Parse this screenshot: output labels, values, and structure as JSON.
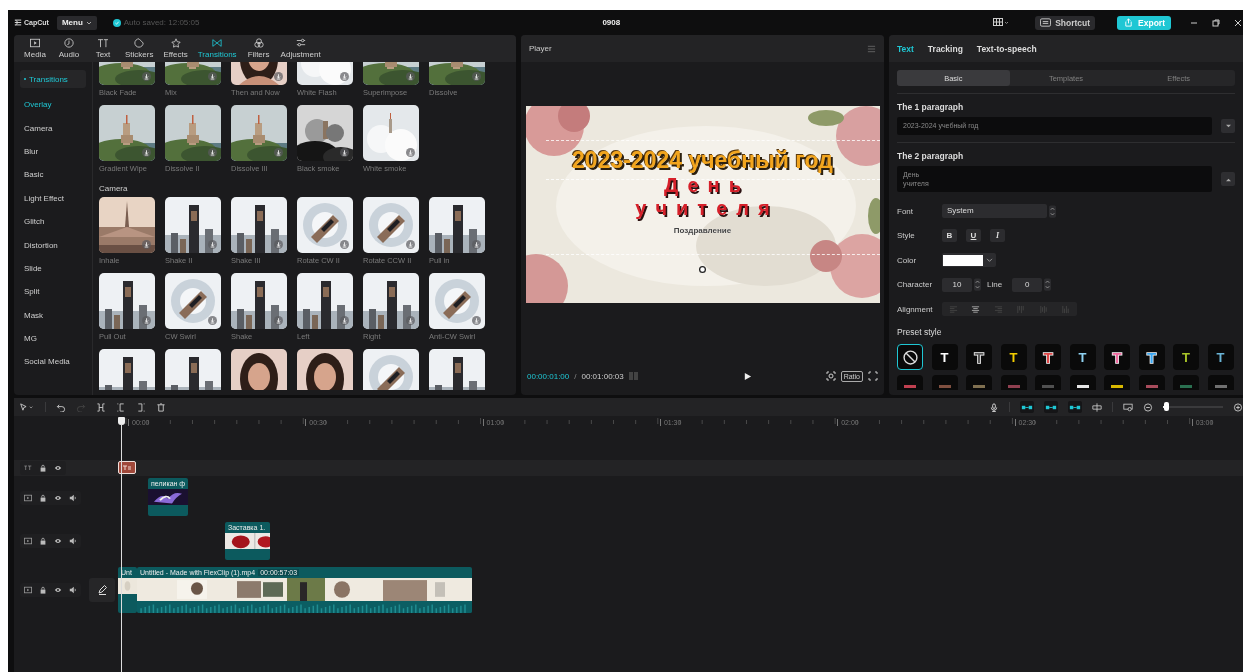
{
  "topbar": {
    "app_name": "CapCut",
    "menu": "Menu",
    "autosave": "Auto saved: 12:05:05",
    "project": "0908",
    "shortcut": "Shortcut",
    "export": "Export"
  },
  "media_tabs": [
    {
      "label": "Media",
      "selected": false
    },
    {
      "label": "Audio",
      "selected": false
    },
    {
      "label": "Text",
      "selected": false
    },
    {
      "label": "Stickers",
      "selected": false
    },
    {
      "label": "Effects",
      "selected": false
    },
    {
      "label": "Transitions",
      "selected": true
    },
    {
      "label": "Filters",
      "selected": false
    },
    {
      "label": "Adjustment",
      "selected": false
    }
  ],
  "sidebar": {
    "items": [
      {
        "label": "Transitions",
        "selected": true,
        "current": false
      },
      {
        "label": "Overlay",
        "selected": false,
        "current": true
      },
      {
        "label": "Camera",
        "selected": false,
        "current": false
      },
      {
        "label": "Blur",
        "selected": false,
        "current": false
      },
      {
        "label": "Basic",
        "selected": false,
        "current": false
      },
      {
        "label": "Light Effect",
        "selected": false,
        "current": false
      },
      {
        "label": "Glitch",
        "selected": false,
        "current": false
      },
      {
        "label": "Distortion",
        "selected": false,
        "current": false
      },
      {
        "label": "Slide",
        "selected": false,
        "current": false
      },
      {
        "label": "Split",
        "selected": false,
        "current": false
      },
      {
        "label": "Mask",
        "selected": false,
        "current": false
      },
      {
        "label": "MG",
        "selected": false,
        "current": false
      },
      {
        "label": "Social Media",
        "selected": false,
        "current": false
      }
    ]
  },
  "library": {
    "sections": [
      {
        "items": [
          {
            "label": "Black Fade"
          },
          {
            "label": "Mix"
          },
          {
            "label": "Then and Now"
          },
          {
            "label": "White Flash"
          },
          {
            "label": "Superimpose"
          },
          {
            "label": "Dissolve"
          },
          {
            "label": "Gradient Wipe"
          },
          {
            "label": "Dissolve II"
          },
          {
            "label": "Dissolve III"
          },
          {
            "label": "Black smoke"
          },
          {
            "label": "White smoke"
          }
        ]
      },
      {
        "heading": "Camera",
        "items": [
          {
            "label": "Inhale"
          },
          {
            "label": "Shake II"
          },
          {
            "label": "Shake III"
          },
          {
            "label": "Rotate CW II"
          },
          {
            "label": "Rotate CCW II"
          },
          {
            "label": "Pull in"
          },
          {
            "label": "Pull Out"
          },
          {
            "label": "CW Swirl"
          },
          {
            "label": "Shake"
          },
          {
            "label": "Left"
          },
          {
            "label": "Right"
          },
          {
            "label": "Anti-CW Swirl"
          },
          {
            "kind": "picture"
          },
          {
            "kind": "picture"
          },
          {
            "kind": "picture"
          },
          {
            "kind": "picture"
          },
          {
            "kind": "picture"
          },
          {
            "kind": "picture"
          }
        ]
      }
    ]
  },
  "player": {
    "title": "Player",
    "overlay_texts": [
      {
        "kind": "title",
        "text": "2023-2024 учебный год"
      },
      {
        "kind": "heading",
        "text": "День"
      },
      {
        "kind": "heading",
        "text": "учителя"
      },
      {
        "kind": "caption",
        "text": "Поздравление"
      }
    ],
    "current_time": "00:00:01:00",
    "separator": "/",
    "duration": "00:01:00:03",
    "ratio": "Ratio"
  },
  "inspector": {
    "tabs": [
      {
        "label": "Text",
        "selected": true
      },
      {
        "label": "Tracking",
        "selected": false
      },
      {
        "label": "Text-to-speech",
        "selected": false
      }
    ],
    "subtabs": [
      {
        "label": "Basic",
        "selected": true
      },
      {
        "label": "Templates",
        "selected": false
      },
      {
        "label": "Effects",
        "selected": false
      }
    ],
    "paragraphs": [
      {
        "label": "The 1 paragraph",
        "value": "2023-2024 учебный год",
        "expanded": false
      },
      {
        "label": "The 2 paragraph",
        "value": "День\nучителя",
        "expanded": true
      }
    ],
    "font": {
      "label": "Font",
      "value": "System"
    },
    "style": {
      "label": "Style",
      "buttons": [
        "B",
        "U",
        "I"
      ]
    },
    "color": {
      "label": "Color",
      "color": "#ffffff"
    },
    "spacing": {
      "character_label": "Character",
      "character": "10",
      "line_label": "Line",
      "line": "0"
    },
    "alignment": {
      "label": "Alignment",
      "options": [
        {
          "selected": false
        },
        {
          "selected": true
        },
        {
          "selected": false
        },
        {
          "selected": false
        },
        {
          "selected": false
        },
        {
          "selected": false
        }
      ]
    },
    "presets": {
      "label": "Preset style",
      "items": [
        {
          "kind": "none",
          "selected": true
        },
        {
          "kind": "text",
          "glyph": "T",
          "color": "#ffffff",
          "selected": false
        },
        {
          "kind": "outline",
          "glyph": "T",
          "color": "#5a5a5a",
          "selected": false
        },
        {
          "kind": "text",
          "glyph": "T",
          "color": "#f2cc00",
          "selected": false
        },
        {
          "kind": "outline",
          "glyph": "T",
          "color": "#e04848",
          "selected": false
        },
        {
          "kind": "text",
          "glyph": "T",
          "color": "#8fd2f2",
          "selected": false
        },
        {
          "kind": "outline",
          "glyph": "T",
          "color": "#f06aa0",
          "selected": false
        },
        {
          "kind": "outline",
          "glyph": "T",
          "color": "#3aa6f0",
          "selected": false
        },
        {
          "kind": "text",
          "glyph": "T",
          "color": "#a8c428",
          "selected": false
        },
        {
          "kind": "text",
          "glyph": "T",
          "color": "#6ab4d6",
          "selected": false
        },
        {
          "kind": "cut",
          "color": "#c04050"
        },
        {
          "kind": "cut",
          "color": "#805040"
        },
        {
          "kind": "cut",
          "color": "#807050"
        },
        {
          "kind": "cut",
          "color": "#904050"
        },
        {
          "kind": "cut",
          "color": "#505050"
        },
        {
          "kind": "cut",
          "color": "#e6e6e6"
        },
        {
          "kind": "cut",
          "color": "#d8b800"
        },
        {
          "kind": "cut",
          "color": "#a84c5c"
        },
        {
          "kind": "cut",
          "color": "#2a7050"
        },
        {
          "kind": "cut",
          "color": "#707070"
        }
      ]
    }
  },
  "timeline": {
    "redo_disabled": true,
    "toggles": [
      {
        "on": true
      },
      {
        "on": true
      },
      {
        "on": true
      }
    ],
    "zoom": {
      "level": 0.05
    },
    "ruler": [
      "00:00",
      "00:30",
      "01:00",
      "01:30",
      "02:00",
      "02:30",
      "03:00"
    ],
    "tracks": [
      {
        "kind": "text",
        "clips": [
          {
            "kind": "text"
          }
        ]
      },
      {
        "kind": "video",
        "clips": [
          {
            "kind": "video",
            "name": "пеликан ф"
          }
        ]
      },
      {
        "kind": "video",
        "clips": [
          {
            "kind": "video",
            "name": "Заставка 1."
          }
        ]
      },
      {
        "kind": "main",
        "clips": [
          {
            "kind": "video",
            "name": "Unt"
          },
          {
            "kind": "main",
            "name": "Untitled - Made with FlexClip (1).mp4",
            "duration": "00:00:57:03"
          }
        ]
      }
    ]
  }
}
